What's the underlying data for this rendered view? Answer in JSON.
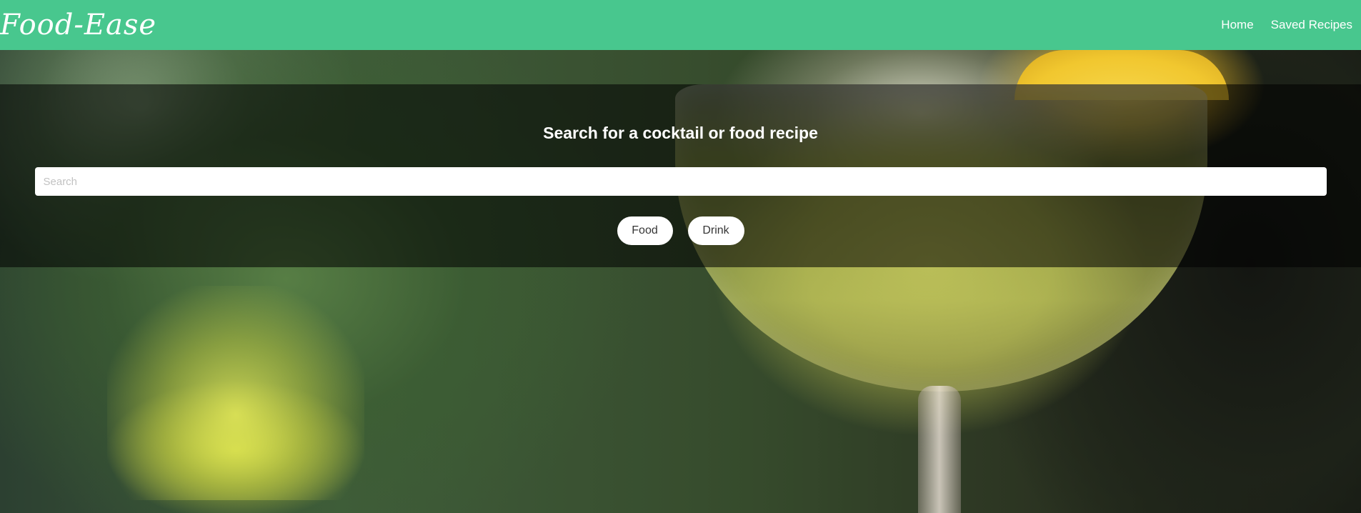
{
  "navbar": {
    "brand": "Food-Ease",
    "links": [
      {
        "label": "Home"
      },
      {
        "label": "Saved Recipes"
      }
    ],
    "background_color": "#48c78e"
  },
  "hero": {
    "background_image_description": "cocktail-glass-photo"
  },
  "search": {
    "title": "Search for a cocktail or food recipe",
    "placeholder": "Search",
    "value": "",
    "buttons": [
      {
        "label": "Food"
      },
      {
        "label": "Drink"
      }
    ]
  }
}
